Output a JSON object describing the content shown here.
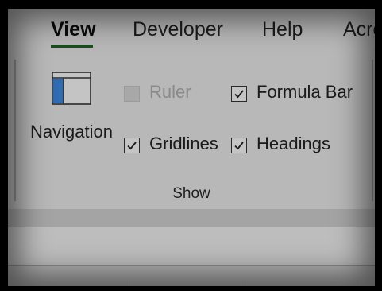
{
  "tabs": {
    "view": "View",
    "developer": "Developer",
    "help": "Help",
    "acrobat": "Acro"
  },
  "show_group": {
    "label": "Show",
    "navigation": {
      "label": "Navigation",
      "icon": "navigation-pane-icon"
    },
    "ruler": {
      "label": "Ruler",
      "checked": false,
      "enabled": false
    },
    "formula_bar": {
      "label": "Formula Bar",
      "checked": true,
      "enabled": true
    },
    "gridlines": {
      "label": "Gridlines",
      "checked": true,
      "enabled": true
    },
    "headings": {
      "label": "Headings",
      "checked": true,
      "enabled": true
    }
  },
  "colors": {
    "active_tab_underline": "#1a4d1f",
    "nav_icon_accent": "#2e6bb0"
  }
}
